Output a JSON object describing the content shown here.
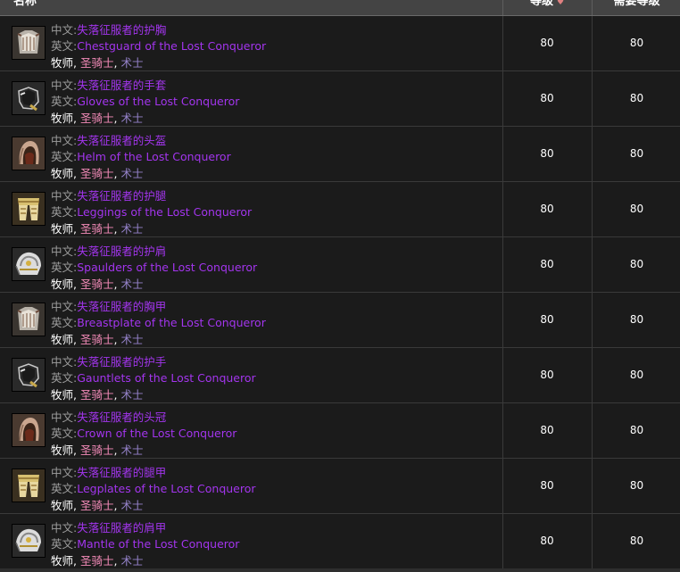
{
  "header": {
    "name_label": "名称",
    "level_label": "等级",
    "req_label": "需要等级",
    "sort_icon": "heart-sort-icon"
  },
  "labels": {
    "zh_prefix": "中文:",
    "en_prefix": "英文:",
    "sep": ", "
  },
  "classes": {
    "priest": "牧师",
    "paladin": "圣骑士",
    "warlock": "术士"
  },
  "colors": {
    "epic": "#a335ee",
    "priest": "#ffffff",
    "paladin": "#f58cba",
    "warlock": "#9482c9"
  },
  "rows": [
    {
      "zh": "失落征服者的护胸",
      "en": "Chestguard of the Lost Conqueror",
      "level": "80",
      "req": "80",
      "icon": "chest-armor-icon"
    },
    {
      "zh": "失落征服者的手套",
      "en": "Gloves of the Lost Conqueror",
      "level": "80",
      "req": "80",
      "icon": "gloves-icon"
    },
    {
      "zh": "失落征服者的头盔",
      "en": "Helm of the Lost Conqueror",
      "level": "80",
      "req": "80",
      "icon": "hood-helm-icon"
    },
    {
      "zh": "失落征服者的护腿",
      "en": "Leggings of the Lost Conqueror",
      "level": "80",
      "req": "80",
      "icon": "legs-armor-icon"
    },
    {
      "zh": "失落征服者的护肩",
      "en": "Spaulders of the Lost Conqueror",
      "level": "80",
      "req": "80",
      "icon": "shoulder-armor-icon"
    },
    {
      "zh": "失落征服者的胸甲",
      "en": "Breastplate of the Lost Conqueror",
      "level": "80",
      "req": "80",
      "icon": "chest-armor-icon"
    },
    {
      "zh": "失落征服者的护手",
      "en": "Gauntlets of the Lost Conqueror",
      "level": "80",
      "req": "80",
      "icon": "gloves-icon"
    },
    {
      "zh": "失落征服者的头冠",
      "en": "Crown of the Lost Conqueror",
      "level": "80",
      "req": "80",
      "icon": "hood-helm-icon"
    },
    {
      "zh": "失落征服者的腿甲",
      "en": "Legplates of the Lost Conqueror",
      "level": "80",
      "req": "80",
      "icon": "legs-armor-icon"
    },
    {
      "zh": "失落征服者的肩甲",
      "en": "Mantle of the Lost Conqueror",
      "level": "80",
      "req": "80",
      "icon": "shoulder-armor-icon"
    }
  ]
}
